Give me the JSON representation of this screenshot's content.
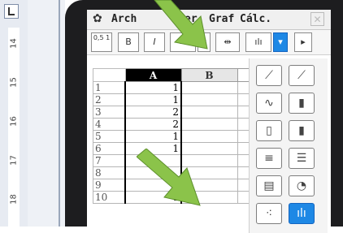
{
  "ruler": {
    "numbers": [
      "14",
      "15",
      "16",
      "17",
      "18"
    ]
  },
  "menubar": {
    "items": [
      {
        "label": "Arch"
      },
      {
        "label": "er"
      },
      {
        "label": "Graf"
      },
      {
        "label": "Cálc."
      }
    ],
    "close_label": "✕"
  },
  "toolbar": {
    "buttons": [
      {
        "label": "0,5 1"
      },
      {
        "label": "B"
      },
      {
        "label": "I"
      },
      {
        "label": "≡"
      },
      {
        "label": "▾"
      },
      {
        "label": "⇹"
      },
      {
        "label": "ılı"
      },
      {
        "label": "▾"
      },
      {
        "label": "▸"
      }
    ]
  },
  "sheet": {
    "columns": [
      "A",
      "B"
    ],
    "rows": [
      {
        "n": "1",
        "a": "1"
      },
      {
        "n": "2",
        "a": "1"
      },
      {
        "n": "3",
        "a": "2"
      },
      {
        "n": "4",
        "a": "2"
      },
      {
        "n": "5",
        "a": "1"
      },
      {
        "n": "6",
        "a": "1"
      },
      {
        "n": "7",
        "a": ""
      },
      {
        "n": "8",
        "a": ""
      },
      {
        "n": "9",
        "a": "0"
      },
      {
        "n": "10",
        "a": "1"
      }
    ]
  },
  "graph_panel": {
    "types": [
      {
        "icon": "line-graph-icon",
        "glyph": "⟋"
      },
      {
        "icon": "line-graph-alt-icon",
        "glyph": "⟋"
      },
      {
        "icon": "area-graph-icon",
        "glyph": "∿"
      },
      {
        "icon": "bar-graph-icon",
        "glyph": "▮"
      },
      {
        "icon": "stacked-bar-icon",
        "glyph": "▯"
      },
      {
        "icon": "column-group-icon",
        "glyph": "▮"
      },
      {
        "icon": "horizontal-bar-icon",
        "glyph": "≡"
      },
      {
        "icon": "horizontal-stacked-icon",
        "glyph": "☰"
      },
      {
        "icon": "hbar-group-icon",
        "glyph": "▤"
      },
      {
        "icon": "pie-chart-icon",
        "glyph": "◔"
      },
      {
        "icon": "scatter-plot-icon",
        "glyph": "⁖"
      },
      {
        "icon": "histogram-icon",
        "glyph": "ılı"
      }
    ],
    "selected_index": 11
  },
  "colors": {
    "accent": "#1e88e5",
    "arrow": "#8bc34a",
    "device": "#1d1d1f"
  }
}
